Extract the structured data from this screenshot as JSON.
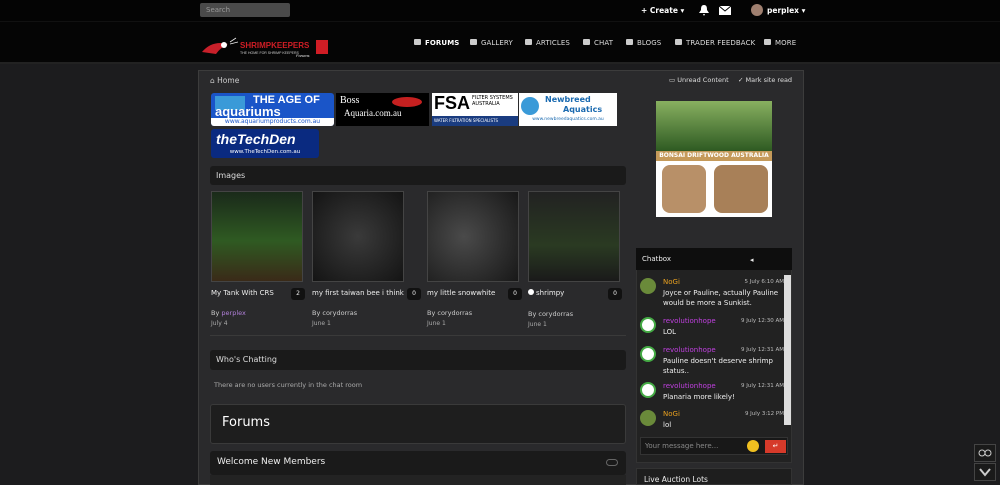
{
  "topbar": {
    "search_placeholder": "Search",
    "create_label": "+ Create ▾",
    "user_label": "perplex ▾"
  },
  "nav": {
    "items": [
      "FORUMS",
      "GALLERY",
      "ARTICLES",
      "CHAT",
      "BLOGS",
      "TRADER FEEDBACK",
      "MORE"
    ]
  },
  "breadcrumb": {
    "home": "Home",
    "unread": "Unread Content",
    "mark_read": "Mark site read"
  },
  "banners": {
    "age_title": "THE AGE OF",
    "age_big": "aquariums",
    "age_url": "www.aquariumproducts.com.au",
    "boss_line1": "Boss",
    "boss_line2": "Aquaria.com.au",
    "fsa_big": "FSA",
    "fsa_sub": "FILTER SYSTEMS AUSTRALIA",
    "fsa_tag": "WATER  FILTRATION  SPECIALISTS",
    "newbreed_line1": "Newbreed",
    "newbreed_line2": "Aquatics",
    "newbreed_url": "www.newbreedaquatics.com.au",
    "techden_big": "theTechDen",
    "techden_url": "www.TheTechDen.com.au",
    "bonsai_title": "BONSAI DRIFTWOOD AUSTRALIA"
  },
  "logo": {
    "text": "SHRIMPKEEPERS",
    "tagline": "THE HOME FOR SHRIMP KEEPERS",
    "badge": "Forums"
  },
  "images": {
    "title": "Images",
    "items": [
      {
        "caption": "My Tank With CRS",
        "count": "2",
        "by": "By",
        "author": "perplex",
        "date": "July 4"
      },
      {
        "caption": "my first taiwan bee i think",
        "count": "0",
        "by": "By corydorras",
        "author": "",
        "date": "June 1"
      },
      {
        "caption": "my little snowwhite",
        "count": "0",
        "by": "By corydorras",
        "author": "",
        "date": "June 1"
      },
      {
        "caption": "shrimpy",
        "count": "0",
        "by": "By corydorras",
        "author": "",
        "date": "June 1"
      }
    ]
  },
  "whos_chatting": {
    "title": "Who's Chatting",
    "text": "There are no users currently in the chat room"
  },
  "forums": {
    "title": "Forums"
  },
  "welcome": {
    "title": "Welcome New Members"
  },
  "chatbox": {
    "title": "Chatbox",
    "messages": [
      {
        "name": "NoGi",
        "time": "5 July 6:10 AM",
        "text": "Joyce or Pauline, actually Pauline would be more a Sunkist.",
        "color": "#e8a020"
      },
      {
        "name": "revolutionhope",
        "time": "9 July 12:30 AM",
        "text": "LOL",
        "color": "#c040e0"
      },
      {
        "name": "revolutionhope",
        "time": "9 July 12:31 AM",
        "text": "Pauline doesn't deserve shrimp status..",
        "color": "#c040e0"
      },
      {
        "name": "revolutionhope",
        "time": "9 July 12:31 AM",
        "text": "Planaria more likely!",
        "color": "#c040e0"
      },
      {
        "name": "NoGi",
        "time": "9 July 3:12 PM",
        "text": "lol",
        "color": "#e8a020"
      }
    ],
    "input_placeholder": "Your message here...",
    "send_label": "↵"
  },
  "auction": {
    "title": "Live Auction Lots"
  }
}
